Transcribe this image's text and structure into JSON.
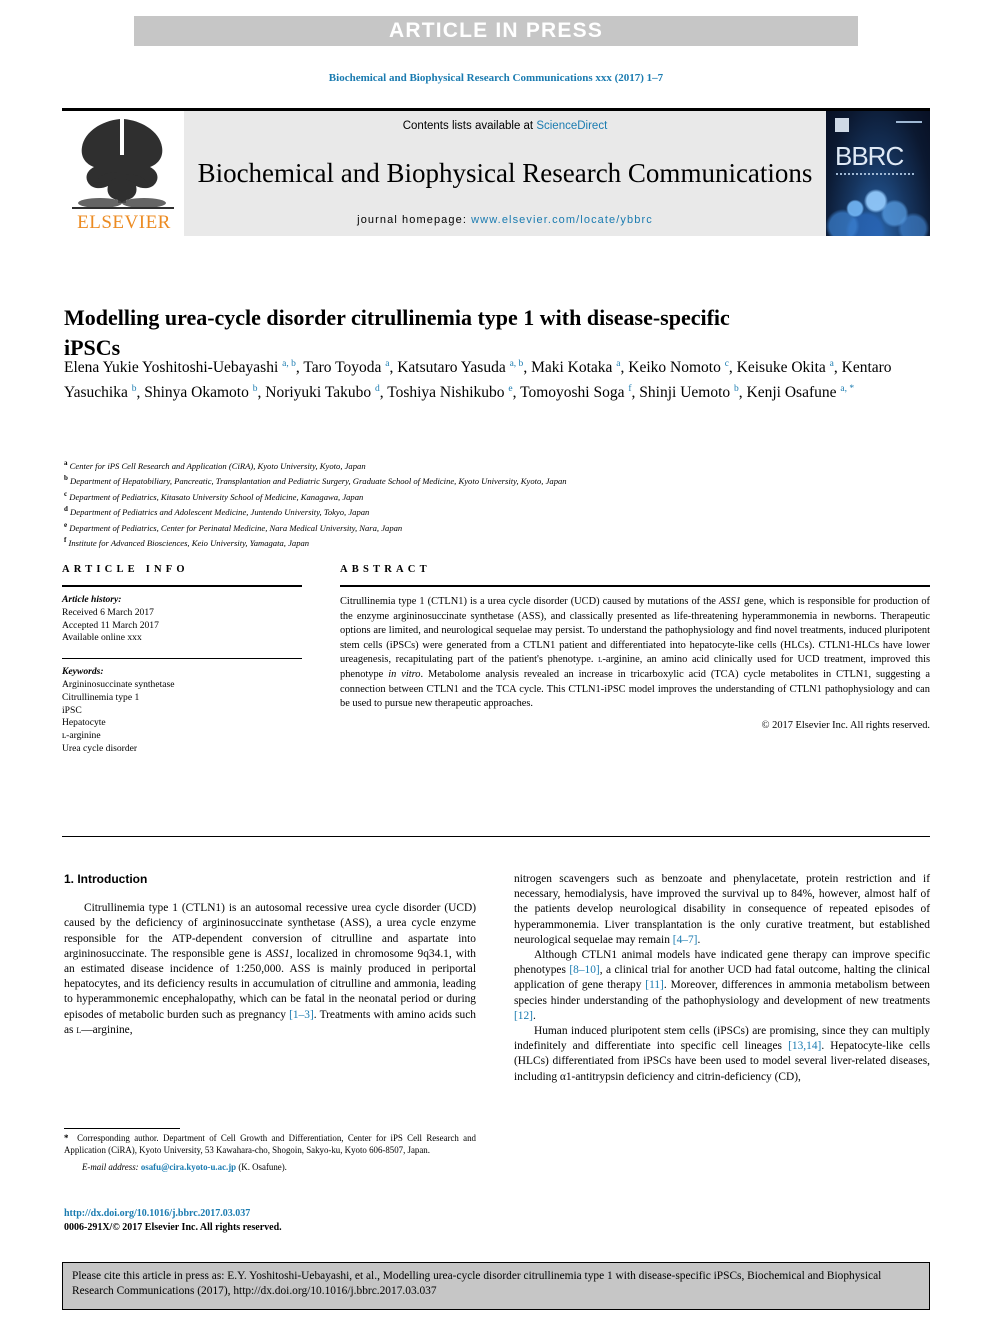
{
  "banner": {
    "press_label": "ARTICLE IN PRESS"
  },
  "running_head": "Biochemical and Biophysical Research Communications xxx (2017) 1–7",
  "masthead": {
    "contents_prefix": "Contents lists available at ",
    "sciencedirect": "ScienceDirect",
    "journal_title": "Biochemical and Biophysical Research Communications",
    "homepage_prefix": "journal homepage: ",
    "homepage_url": "www.elsevier.com/locate/ybbrc",
    "publisher_wordmark": "ELSEVIER",
    "cover_wordmark": "BBRC",
    "accent_blue": "#1a7bb0",
    "elsevier_orange": "#ec8b22",
    "banner_gray": "#c6c6c6",
    "masthead_gray": "#e9e9e9"
  },
  "article": {
    "title": "Modelling urea-cycle disorder citrullinemia type 1 with disease-specific iPSCs",
    "authors_html": "Elena Yukie Yoshitoshi-Uebayashi <sup>a, b</sup>, Taro Toyoda <sup>a</sup>, Katsutaro Yasuda <sup>a, b</sup>, Maki Kotaka <sup>a</sup>, Keiko Nomoto <sup>c</sup>, Keisuke Okita <sup>a</sup>, Kentaro Yasuchika <sup>b</sup>, Shinya Okamoto <sup>b</sup>, Noriyuki Takubo <sup>d</sup>, Toshiya Nishikubo <sup>e</sup>, Tomoyoshi Soga <sup>f</sup>, Shinji Uemoto <sup>b</sup>, Kenji Osafune <sup>a, *</sup>",
    "affiliations": [
      {
        "mark": "a",
        "text": "Center for iPS Cell Research and Application (CiRA), Kyoto University, Kyoto, Japan"
      },
      {
        "mark": "b",
        "text": "Department of Hepatobiliary, Pancreatic, Transplantation and Pediatric Surgery, Graduate School of Medicine, Kyoto University, Kyoto, Japan"
      },
      {
        "mark": "c",
        "text": "Department of Pediatrics, Kitasato University School of Medicine, Kanagawa, Japan"
      },
      {
        "mark": "d",
        "text": "Department of Pediatrics and Adolescent Medicine, Juntendo University, Tokyo, Japan"
      },
      {
        "mark": "e",
        "text": "Department of Pediatrics, Center for Perinatal Medicine, Nara Medical University, Nara, Japan"
      },
      {
        "mark": "f",
        "text": "Institute for Advanced Biosciences, Keio University, Yamagata, Japan"
      }
    ]
  },
  "article_info": {
    "heading": "ARTICLE INFO",
    "history_label": "Article history:",
    "history": [
      "Received 6 March 2017",
      "Accepted 11 March 2017",
      "Available online xxx"
    ],
    "keywords_label": "Keywords:",
    "keywords": [
      "Argininosuccinate synthetase",
      "Citrullinemia type 1",
      "iPSC",
      "Hepatocyte",
      "ʟ-arginine",
      "Urea cycle disorder"
    ]
  },
  "abstract": {
    "heading": "ABSTRACT",
    "body_html": "Citrullinemia type 1 (CTLN1) is a urea cycle disorder (UCD) caused by mutations of the <i>ASS1</i> gene, which is responsible for production of the enzyme argininosuccinate synthetase (ASS), and classically presented as life-threatening hyperammonemia in newborns. Therapeutic options are limited, and neurological sequelae may persist. To understand the pathophysiology and find novel treatments, induced pluripotent stem cells (iPSCs) were generated from a CTLN1 patient and differentiated into hepatocyte-like cells (HLCs). CTLN1-HLCs have lower ureagenesis, recapitulating part of the patient's phenotype. <span class=\"sc\">l</span>-arginine, an amino acid clinically used for UCD treatment, improved this phenotype <i>in vitro</i>. Metabolome analysis revealed an increase in tricarboxylic acid (TCA) cycle metabolites in CTLN1, suggesting a connection between CTLN1 and the TCA cycle. This CTLN1-iPSC model improves the understanding of CTLN1 pathophysiology and can be used to pursue new therapeutic approaches.",
    "copyright": "© 2017 Elsevier Inc. All rights reserved."
  },
  "sections": {
    "intro_heading": "1.  Introduction",
    "left_paragraphs_html": [
      "Citrullinemia type 1 (CTLN1) is an autosomal recessive urea cycle disorder (UCD) caused by the deficiency of argininosuccinate synthetase (ASS), a urea cycle enzyme responsible for the ATP-dependent conversion of citrulline and aspartate into argininosuccinate. The responsible gene is <i class=\"ital\">ASS1</i>, localized in chromosome 9q34.1, with an estimated disease incidence of 1:250,000. ASS is mainly produced in periportal hepatocytes, and its deficiency results in accumulation of citrulline and ammonia, leading to hyperammonemic encephalopathy, which can be fatal in the neonatal period or during episodes of metabolic burden such as pregnancy <span class=\"ref\">[1–3]</span>. Treatments with amino acids such as <span class=\"sc\">l</span>—arginine,"
    ],
    "right_paragraphs_html": [
      "nitrogen scavengers such as benzoate and phenylacetate, protein restriction and if necessary, hemodialysis, have improved the survival up to 84%, however, almost half of the patients develop neurological disability in consequence of repeated episodes of hyperammonemia. Liver transplantation is the only curative treatment, but established neurological sequelae may remain <span class=\"ref\">[4–7]</span>.",
      "Although CTLN1 animal models have indicated gene therapy can improve specific phenotypes <span class=\"ref\">[8–10]</span>, a clinical trial for another UCD had fatal outcome, halting the clinical application of gene therapy <span class=\"ref\">[11]</span>. Moreover, differences in ammonia metabolism between species hinder understanding of the pathophysiology and development of new treatments <span class=\"ref\">[12]</span>.",
      "Human induced pluripotent stem cells (iPSCs) are promising, since they can multiply indefinitely and differentiate into specific cell lineages <span class=\"ref\">[13,14]</span>. Hepatocyte-like cells (HLCs) differentiated from iPSCs have been used to model several liver-related diseases, including α1-antitrypsin deficiency and citrin-deficiency (CD),"
    ]
  },
  "footnote": {
    "corresponding_html": "<span class=\"star\">*</span>&nbsp; Corresponding author. Department of Cell Growth and Differentiation, Center for iPS Cell Research and Application (CiRA), Kyoto University, 53 Kawahara-cho, Shogoin, Sakyo-ku, Kyoto 606-8507, Japan.",
    "email_label": "E-mail address:",
    "email_address": "osafu@cira.kyoto-u.ac.jp",
    "email_owner": "(K. Osafune).",
    "doi": "http://dx.doi.org/10.1016/j.bbrc.2017.03.037",
    "issn_line": "0006-291X/© 2017 Elsevier Inc. All rights reserved."
  },
  "cite_footer": {
    "text": "Please cite this article in press as: E.Y. Yoshitoshi-Uebayashi, et al., Modelling urea-cycle disorder citrullinemia type 1 with disease-specific iPSCs, Biochemical and Biophysical Research Communications (2017), http://dx.doi.org/10.1016/j.bbrc.2017.03.037"
  }
}
